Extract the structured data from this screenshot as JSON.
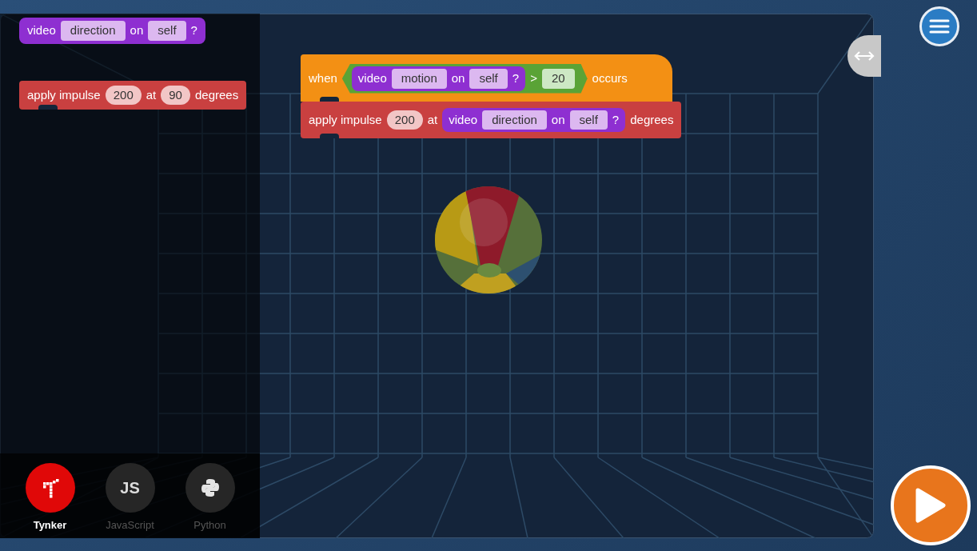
{
  "palette_blocks": [
    {
      "kind": "reporter",
      "parts": [
        {
          "kind": "text",
          "text": "video"
        },
        {
          "kind": "field",
          "text": "direction"
        },
        {
          "kind": "text",
          "text": "on"
        },
        {
          "kind": "field",
          "text": "self"
        },
        {
          "kind": "text",
          "text": "?"
        }
      ]
    },
    {
      "kind": "command",
      "parts": [
        {
          "kind": "text",
          "text": "apply impulse"
        },
        {
          "kind": "number",
          "text": "200"
        },
        {
          "kind": "text",
          "text": "at"
        },
        {
          "kind": "number",
          "text": "90"
        },
        {
          "kind": "text",
          "text": "degrees"
        }
      ]
    }
  ],
  "script": [
    {
      "kind": "hat",
      "parts": [
        {
          "kind": "text",
          "text": "when"
        },
        {
          "kind": "boolean",
          "parts": [
            {
              "kind": "reporter",
              "parts": [
                {
                  "kind": "text",
                  "text": "video"
                },
                {
                  "kind": "field",
                  "text": "motion"
                },
                {
                  "kind": "text",
                  "text": "on"
                },
                {
                  "kind": "field",
                  "text": "self"
                },
                {
                  "kind": "text",
                  "text": "?"
                }
              ]
            },
            {
              "kind": "text",
              "text": ">"
            },
            {
              "kind": "number",
              "text": "20"
            }
          ]
        },
        {
          "kind": "text",
          "text": "occurs"
        }
      ]
    },
    {
      "kind": "command",
      "parts": [
        {
          "kind": "text",
          "text": "apply impulse"
        },
        {
          "kind": "number",
          "text": "200"
        },
        {
          "kind": "text",
          "text": "at"
        },
        {
          "kind": "reporter",
          "parts": [
            {
              "kind": "text",
              "text": "video"
            },
            {
              "kind": "field",
              "text": "direction"
            },
            {
              "kind": "text",
              "text": "on"
            },
            {
              "kind": "field",
              "text": "self"
            },
            {
              "kind": "text",
              "text": "?"
            }
          ]
        },
        {
          "kind": "text",
          "text": "degrees"
        }
      ]
    }
  ],
  "languages": [
    {
      "kind": "tynker",
      "label": "Tynker",
      "selected": true
    },
    {
      "kind": "js",
      "label": "JavaScript",
      "icon_text": "JS",
      "selected": false
    },
    {
      "kind": "python",
      "label": "Python",
      "selected": false
    }
  ]
}
